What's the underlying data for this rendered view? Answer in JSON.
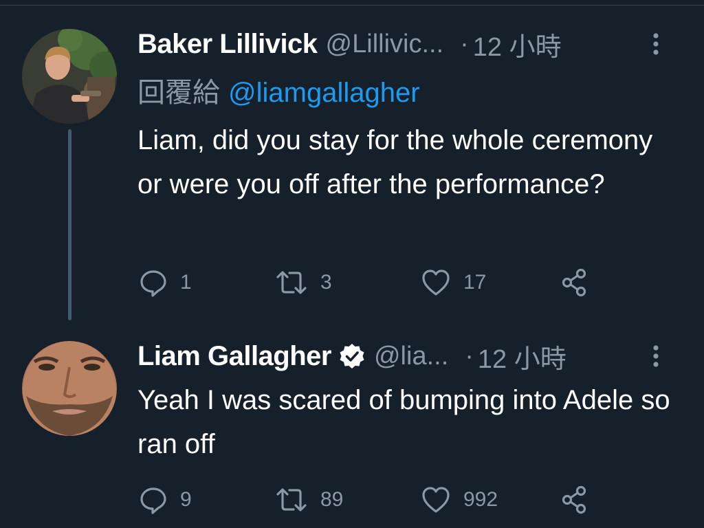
{
  "colors": {
    "background": "#15202b",
    "text_primary": "#ffffff",
    "text_secondary": "#8b98a5",
    "link": "#1d9bf0",
    "thread_line": "#425a6e",
    "divider": "#38444d"
  },
  "tweets": [
    {
      "author": {
        "display_name": "Baker Lillivick",
        "handle": "@Lillivic...",
        "verified": false
      },
      "timestamp": "12 小時",
      "reply_to": {
        "prefix": "回覆給",
        "mention": "@liamgallagher"
      },
      "text": "Liam, did you stay for the whole ceremony or were you off after the performance?",
      "stats": {
        "replies": "1",
        "retweets": "3",
        "likes": "17"
      },
      "icons": [
        "reply-icon",
        "retweet-icon",
        "like-icon",
        "share-icon",
        "more-icon"
      ]
    },
    {
      "author": {
        "display_name": "Liam Gallagher",
        "handle": "@lia...",
        "verified": true
      },
      "timestamp": "12 小時",
      "text": "Yeah I was scared of bumping into Adele so ran off",
      "stats": {
        "replies": "9",
        "retweets": "89",
        "likes": "992"
      },
      "icons": [
        "verified-badge-icon",
        "reply-icon",
        "retweet-icon",
        "like-icon",
        "share-icon",
        "more-icon"
      ]
    }
  ],
  "separator_dot": "·"
}
